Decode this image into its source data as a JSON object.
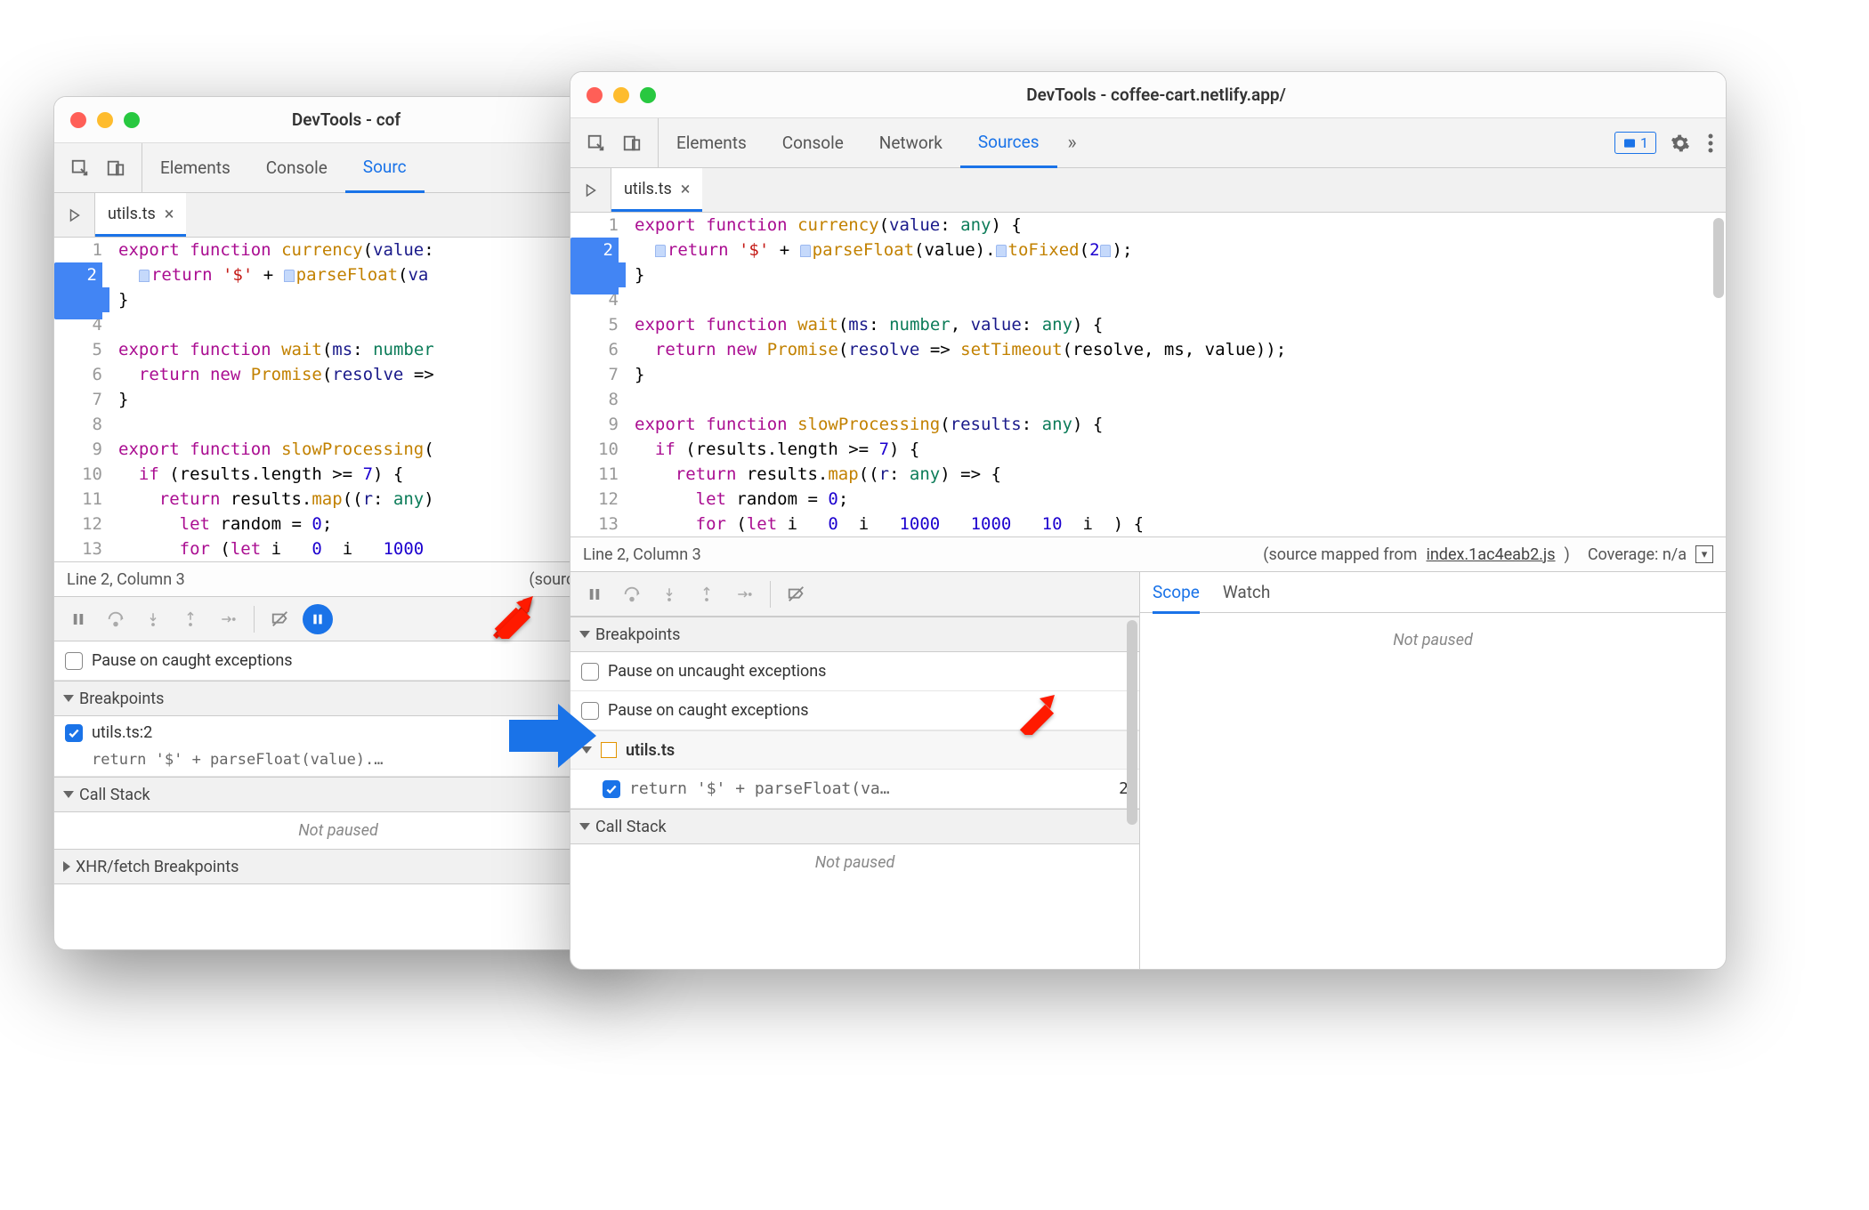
{
  "back_window": {
    "title": "DevTools - cof",
    "tabs": [
      "Elements",
      "Console",
      "Sourc"
    ],
    "active_tab": "Sourc",
    "file_tab": "utils.ts",
    "breakpoint_line": 2,
    "code_lines": [
      {
        "n": 1,
        "html": "<span class='kw'>export</span> <span class='kw'>function</span> <span class='fn'>currency</span>(<span class='id'>value</span>:"
      },
      {
        "n": 2,
        "html": "  <span class='sm-bookmark'></span><span class='kw'>return</span> <span class='str'>'$'</span> + <span class='sm-bookmark'></span><span class='fn'>parseFloat</span>(<span class='id'>va</span>"
      },
      {
        "n": 3,
        "html": "}"
      },
      {
        "n": 4,
        "html": ""
      },
      {
        "n": 5,
        "html": "<span class='kw'>export</span> <span class='kw'>function</span> <span class='fn'>wait</span>(<span class='id'>ms</span>: <span class='ty'>number</span>"
      },
      {
        "n": 6,
        "html": "  <span class='kw'>return</span> <span class='kw'>new</span> <span class='fn'>Promise</span>(<span class='id'>resolve</span> =>"
      },
      {
        "n": 7,
        "html": "}"
      },
      {
        "n": 8,
        "html": ""
      },
      {
        "n": 9,
        "html": "<span class='kw'>export</span> <span class='kw'>function</span> <span class='fn'>slowProcessing</span>("
      },
      {
        "n": 10,
        "html": "  <span class='kw'>if</span> (results.length >= <span class='num'>7</span>) {"
      },
      {
        "n": 11,
        "html": "    <span class='kw'>return</span> results.<span class='fn'>map</span>((<span class='id'>r</span>: <span class='ty'>any</span>)"
      },
      {
        "n": 12,
        "html": "      <span class='kw'>let</span> random = <span class='num'>0</span>;"
      },
      {
        "n": 13,
        "html": "      <span class='kw'>for</span> (<span class='kw'>let</span> i   <span class='num'>0</span>  i   <span class='num'>1000</span>"
      }
    ],
    "status": {
      "pos": "Line 2, Column 3",
      "right": "(source ma"
    },
    "pause_caught_label": "Pause on caught exceptions",
    "breakpoints_header": "Breakpoints",
    "bp_item_label": "utils.ts:2",
    "bp_item_code": "return '$' + parseFloat(value).…",
    "callstack_header": "Call Stack",
    "not_paused": "Not paused",
    "xhr_header": "XHR/fetch Breakpoints"
  },
  "front_window": {
    "title": "DevTools - coffee-cart.netlify.app/",
    "tabs": [
      "Elements",
      "Console",
      "Network",
      "Sources"
    ],
    "active_tab": "Sources",
    "issues_count": "1",
    "file_tab": "utils.ts",
    "breakpoint_line": 2,
    "code_lines": [
      {
        "n": 1,
        "html": "<span class='kw'>export</span> <span class='kw'>function</span> <span class='fn'>currency</span>(<span class='id'>value</span>: <span class='ty'>any</span>) {"
      },
      {
        "n": 2,
        "html": "  <span class='sm-bookmark'></span><span class='kw'>return</span> <span class='str'>'$'</span> + <span class='sm-bookmark'></span><span class='fn'>parseFloat</span>(value).<span class='sm-bookmark'></span><span class='fn'>toFixed</span>(<span class='num'>2</span><span class='sm-bookmark'></span>);"
      },
      {
        "n": 3,
        "html": "}"
      },
      {
        "n": 4,
        "html": ""
      },
      {
        "n": 5,
        "html": "<span class='kw'>export</span> <span class='kw'>function</span> <span class='fn'>wait</span>(<span class='id'>ms</span>: <span class='ty'>number</span>, <span class='id'>value</span>: <span class='ty'>any</span>) {"
      },
      {
        "n": 6,
        "html": "  <span class='kw'>return</span> <span class='kw'>new</span> <span class='fn'>Promise</span>(<span class='id'>resolve</span> => <span class='fn'>setTimeout</span>(resolve, ms, value));"
      },
      {
        "n": 7,
        "html": "}"
      },
      {
        "n": 8,
        "html": ""
      },
      {
        "n": 9,
        "html": "<span class='kw'>export</span> <span class='kw'>function</span> <span class='fn'>slowProcessing</span>(<span class='id'>results</span>: <span class='ty'>any</span>) {"
      },
      {
        "n": 10,
        "html": "  <span class='kw'>if</span> (results.length >= <span class='num'>7</span>) {"
      },
      {
        "n": 11,
        "html": "    <span class='kw'>return</span> results.<span class='fn'>map</span>((<span class='id'>r</span>: <span class='ty'>any</span>) => {"
      },
      {
        "n": 12,
        "html": "      <span class='kw'>let</span> random = <span class='num'>0</span>;"
      },
      {
        "n": 13,
        "html": "      <span class='kw'>for</span> (<span class='kw'>let</span> i   <span class='num'>0</span>  i   <span class='num'>1000</span>   <span class='num'>1000</span>   <span class='num'>10</span>  i  ) {"
      }
    ],
    "status": {
      "pos": "Line 2, Column 3",
      "mapped_from_prefix": "(source mapped from ",
      "mapped_link": "index.1ac4eab2.js",
      "mapped_suffix": ")",
      "coverage_label": "Coverage: n/a"
    },
    "breakpoints_header": "Breakpoints",
    "pause_uncaught_label": "Pause on uncaught exceptions",
    "pause_caught_label": "Pause on caught exceptions",
    "bp_group_label": "utils.ts",
    "bp_item_code": "return '$' + parseFloat(va…",
    "bp_item_line": "2",
    "callstack_header": "Call Stack",
    "not_paused": "Not paused",
    "scope_tabs": [
      "Scope",
      "Watch"
    ],
    "scope_not_paused": "Not paused"
  }
}
